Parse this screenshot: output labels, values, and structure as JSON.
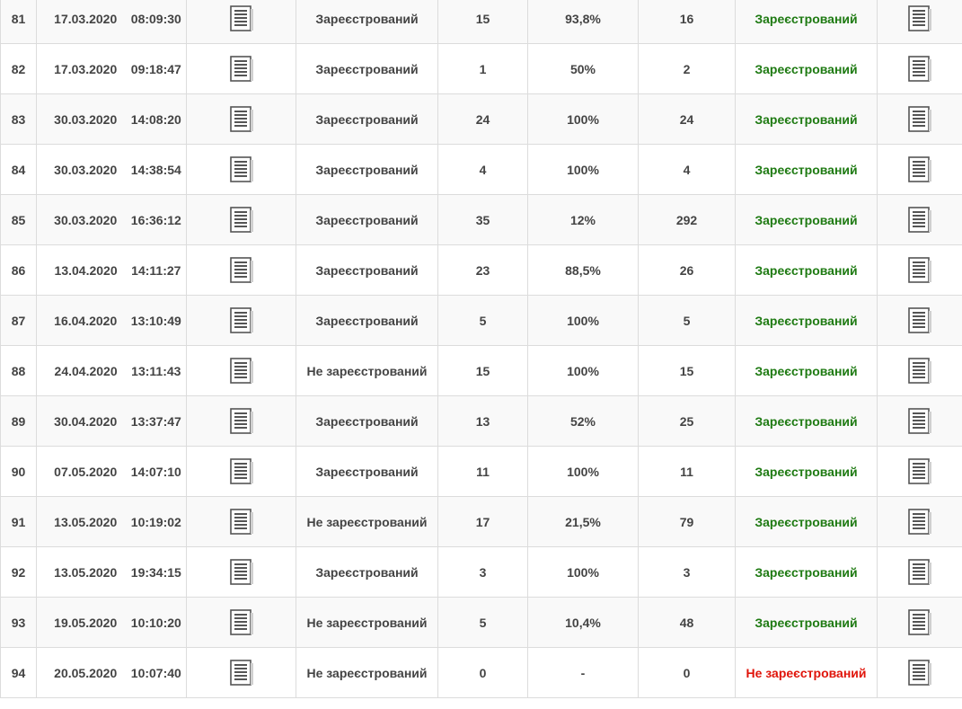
{
  "rows": [
    {
      "num": "81",
      "date": "17.03.2020",
      "time": "08:09:30",
      "state": "Зареєстрований",
      "count": "15",
      "pct": "93,8%",
      "total": "16",
      "final": "Зареєстрований",
      "final_ok": true
    },
    {
      "num": "82",
      "date": "17.03.2020",
      "time": "09:18:47",
      "state": "Зареєстрований",
      "count": "1",
      "pct": "50%",
      "total": "2",
      "final": "Зареєстрований",
      "final_ok": true
    },
    {
      "num": "83",
      "date": "30.03.2020",
      "time": "14:08:20",
      "state": "Зареєстрований",
      "count": "24",
      "pct": "100%",
      "total": "24",
      "final": "Зареєстрований",
      "final_ok": true
    },
    {
      "num": "84",
      "date": "30.03.2020",
      "time": "14:38:54",
      "state": "Зареєстрований",
      "count": "4",
      "pct": "100%",
      "total": "4",
      "final": "Зареєстрований",
      "final_ok": true
    },
    {
      "num": "85",
      "date": "30.03.2020",
      "time": "16:36:12",
      "state": "Зареєстрований",
      "count": "35",
      "pct": "12%",
      "total": "292",
      "final": "Зареєстрований",
      "final_ok": true
    },
    {
      "num": "86",
      "date": "13.04.2020",
      "time": "14:11:27",
      "state": "Зареєстрований",
      "count": "23",
      "pct": "88,5%",
      "total": "26",
      "final": "Зареєстрований",
      "final_ok": true
    },
    {
      "num": "87",
      "date": "16.04.2020",
      "time": "13:10:49",
      "state": "Зареєстрований",
      "count": "5",
      "pct": "100%",
      "total": "5",
      "final": "Зареєстрований",
      "final_ok": true
    },
    {
      "num": "88",
      "date": "24.04.2020",
      "time": "13:11:43",
      "state": "Не зареєстрований",
      "count": "15",
      "pct": "100%",
      "total": "15",
      "final": "Зареєстрований",
      "final_ok": true
    },
    {
      "num": "89",
      "date": "30.04.2020",
      "time": "13:37:47",
      "state": "Зареєстрований",
      "count": "13",
      "pct": "52%",
      "total": "25",
      "final": "Зареєстрований",
      "final_ok": true
    },
    {
      "num": "90",
      "date": "07.05.2020",
      "time": "14:07:10",
      "state": "Зареєстрований",
      "count": "11",
      "pct": "100%",
      "total": "11",
      "final": "Зареєстрований",
      "final_ok": true
    },
    {
      "num": "91",
      "date": "13.05.2020",
      "time": "10:19:02",
      "state": "Не зареєстрований",
      "count": "17",
      "pct": "21,5%",
      "total": "79",
      "final": "Зареєстрований",
      "final_ok": true
    },
    {
      "num": "92",
      "date": "13.05.2020",
      "time": "19:34:15",
      "state": "Зареєстрований",
      "count": "3",
      "pct": "100%",
      "total": "3",
      "final": "Зареєстрований",
      "final_ok": true
    },
    {
      "num": "93",
      "date": "19.05.2020",
      "time": "10:10:20",
      "state": "Не зареєстрований",
      "count": "5",
      "pct": "10,4%",
      "total": "48",
      "final": "Зареєстрований",
      "final_ok": true
    },
    {
      "num": "94",
      "date": "20.05.2020",
      "time": "10:07:40",
      "state": "Не зареєстрований",
      "count": "0",
      "pct": "-",
      "total": "0",
      "final": "Не зареєстрований",
      "final_ok": false
    }
  ],
  "icons": {
    "document": "document-icon"
  },
  "colors": {
    "ok": "#1e7a12",
    "bad": "#e0140a",
    "text": "#444444",
    "border": "#dcdcdc"
  }
}
